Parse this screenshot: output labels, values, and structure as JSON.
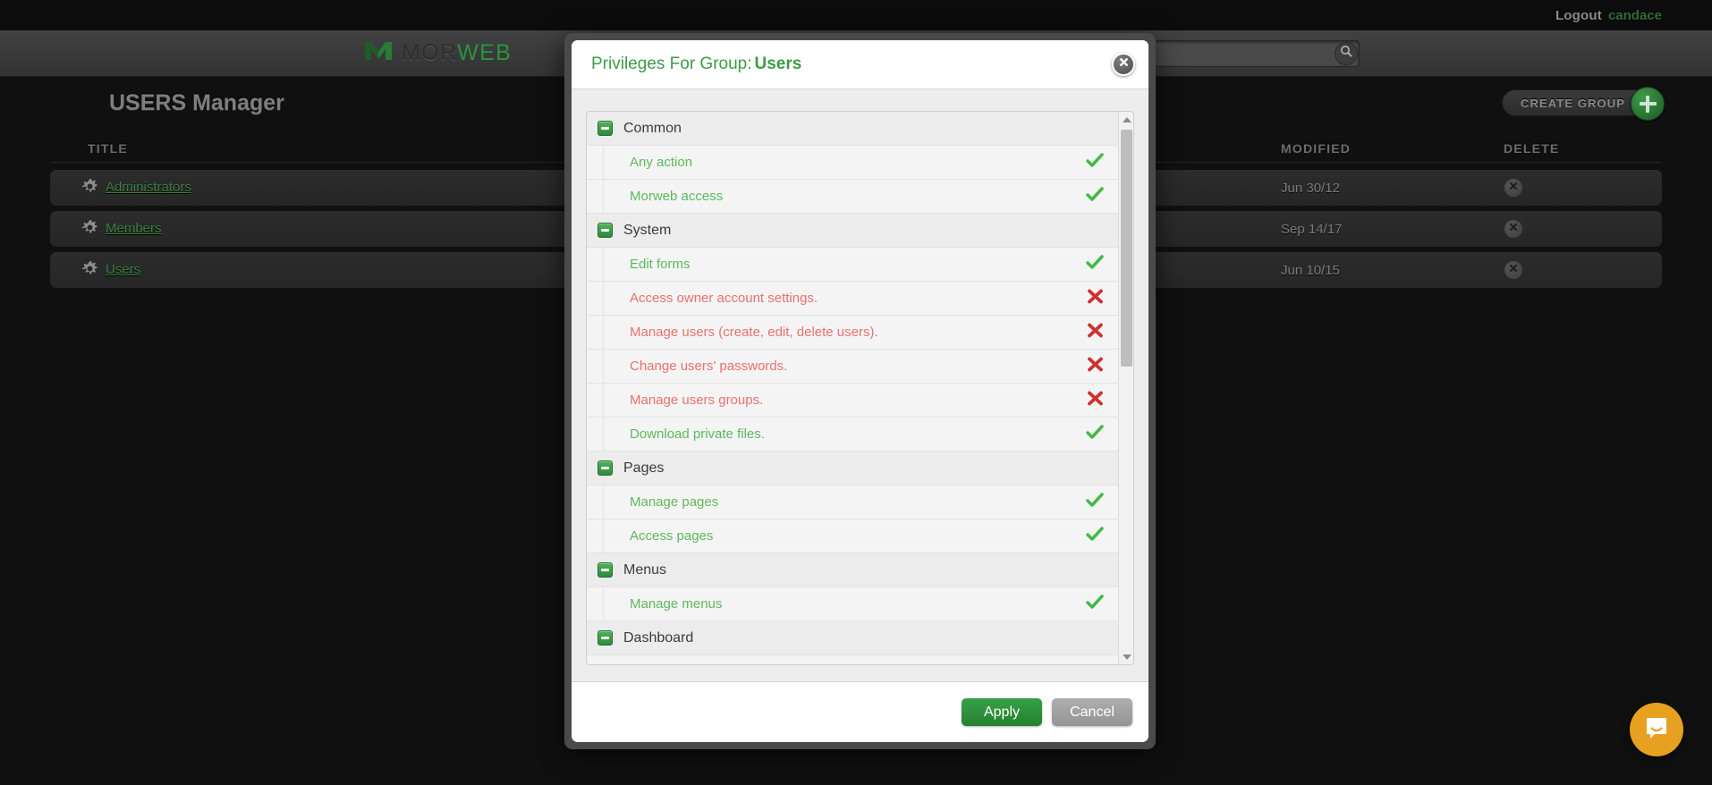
{
  "utility_bar": {
    "logout_label": "Logout",
    "username": "candace"
  },
  "navbar": {
    "brand_part1": "MOR",
    "brand_part2": "WEB",
    "brand_icon": "morweb-logo-icon",
    "search_placeholder": "",
    "search_value": "",
    "search_icon": "search-icon"
  },
  "page": {
    "title": "USERS Manager",
    "create_group_label": "CREATE GROUP",
    "create_group_icon": "plus-icon"
  },
  "table": {
    "columns": {
      "title": "TITLE",
      "modified": "MODIFIED",
      "delete": "DELETE"
    },
    "rows": [
      {
        "icon": "gear-icon",
        "title": "Administrators",
        "modified": "Jun 30/12",
        "delete_icon": "close-circle-icon"
      },
      {
        "icon": "gear-icon",
        "title": "Members",
        "modified": "Sep 14/17",
        "delete_icon": "close-circle-icon"
      },
      {
        "icon": "gear-icon",
        "title": "Users",
        "modified": "Jun 10/15",
        "delete_icon": "close-circle-icon"
      }
    ]
  },
  "modal": {
    "title_prefix": "Privileges For Group:",
    "title_group": "Users",
    "close_icon": "close-circle-icon",
    "privileges": [
      {
        "kind": "group",
        "label": "Common",
        "toggle_icon": "minus-box-icon"
      },
      {
        "kind": "item",
        "label": "Any action",
        "state": "allow",
        "mark_icon": "check-icon"
      },
      {
        "kind": "item",
        "label": "Morweb access",
        "state": "allow",
        "mark_icon": "check-icon"
      },
      {
        "kind": "group",
        "label": "System",
        "toggle_icon": "minus-box-icon"
      },
      {
        "kind": "item",
        "label": "Edit forms",
        "state": "allow",
        "mark_icon": "check-icon"
      },
      {
        "kind": "item",
        "label": "Access owner account settings.",
        "state": "deny",
        "mark_icon": "cross-icon"
      },
      {
        "kind": "item",
        "label": "Manage users (create, edit, delete users).",
        "state": "deny",
        "mark_icon": "cross-icon"
      },
      {
        "kind": "item",
        "label": "Change users' passwords.",
        "state": "deny",
        "mark_icon": "cross-icon"
      },
      {
        "kind": "item",
        "label": "Manage users groups.",
        "state": "deny",
        "mark_icon": "cross-icon"
      },
      {
        "kind": "item",
        "label": "Download private files.",
        "state": "allow",
        "mark_icon": "check-icon"
      },
      {
        "kind": "group",
        "label": "Pages",
        "toggle_icon": "minus-box-icon"
      },
      {
        "kind": "item",
        "label": "Manage pages",
        "state": "allow",
        "mark_icon": "check-icon"
      },
      {
        "kind": "item",
        "label": "Access pages",
        "state": "allow",
        "mark_icon": "check-icon"
      },
      {
        "kind": "group",
        "label": "Menus",
        "toggle_icon": "minus-box-icon"
      },
      {
        "kind": "item",
        "label": "Manage menus",
        "state": "allow",
        "mark_icon": "check-icon"
      },
      {
        "kind": "group",
        "label": "Dashboard",
        "toggle_icon": "minus-box-icon"
      }
    ],
    "scrollbar": {
      "up_icon": "chevron-up-icon",
      "down_icon": "chevron-down-icon"
    },
    "apply_label": "Apply",
    "cancel_label": "Cancel"
  },
  "intercom": {
    "icon": "chat-bubble-icon"
  },
  "colors": {
    "brand_green": "#2f9141",
    "allow_green": "#5cb85c",
    "deny_red": "#e8706e",
    "apply_green": "#2e8f3a",
    "cancel_gray": "#9c9c9c",
    "intercom_orange": "#e8a020",
    "page_background": "#101010"
  }
}
